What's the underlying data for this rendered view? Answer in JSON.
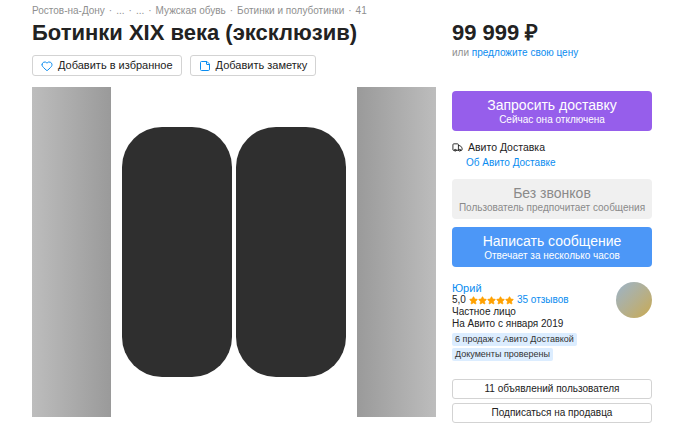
{
  "breadcrumbs": {
    "separator": "·",
    "items": [
      "Ростов-на-Дону",
      "...",
      "...",
      "Мужская обувь",
      "Ботинки и полуботинки",
      "41"
    ]
  },
  "title": "Ботинки XIX века (эксклюзив)",
  "price": "99 999 ₽",
  "price_offer": {
    "prefix": "или",
    "link": "предложите свою цену"
  },
  "actions": [
    "Добавить в избранное",
    "Добавить заметку"
  ],
  "delivery_button": {
    "title": "Запросить доставку",
    "subtitle": "Сейчас она отключена"
  },
  "delivery_info": {
    "label": "Авито Доставка",
    "link": "Об Авито Доставке"
  },
  "calls_button": {
    "title": "Без звонков",
    "subtitle": "Пользователь предпочитает сообщения",
    "disabled": true
  },
  "message_button": {
    "title": "Написать сообщение",
    "subtitle": "Отвечает за несколько часов"
  },
  "seller": {
    "name": "Юрий",
    "rating": "5,0",
    "stars": 5,
    "reviews": "35 отзывов",
    "type": "Частное лицо",
    "since": "На Авито с января 2019",
    "badges": [
      "6 продаж с Авито Доставкой",
      "Документы проверены"
    ]
  },
  "buttons": [
    "11 объявлений пользователя",
    "Подписаться на продавца"
  ]
}
